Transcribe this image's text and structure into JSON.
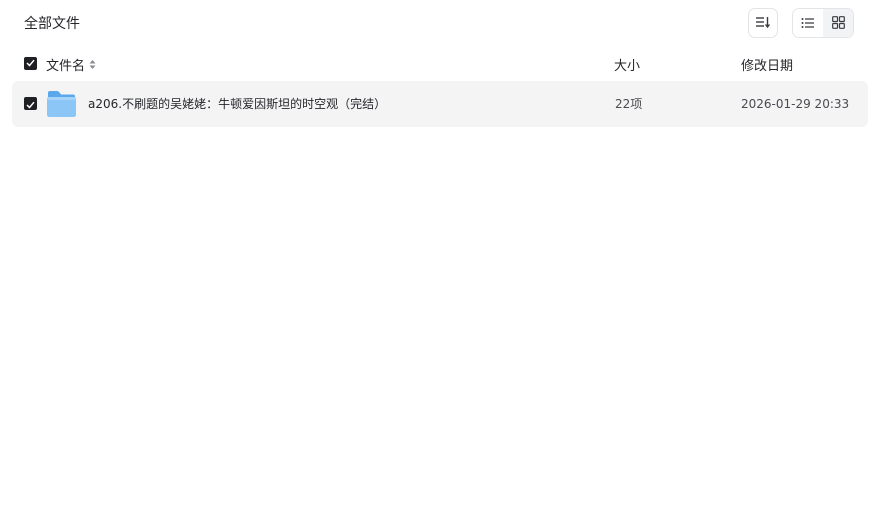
{
  "breadcrumb": {
    "title": "全部文件"
  },
  "toolbar": {
    "sort_icon": "sort-descending-icon",
    "view_list_icon": "list-view-icon",
    "view_grid_icon": "grid-view-icon",
    "active_view": "list"
  },
  "table": {
    "header": {
      "select_all_checked": true,
      "name": "文件名",
      "size": "大小",
      "modified": "修改日期"
    },
    "rows": [
      {
        "checked": true,
        "icon": "folder-icon",
        "name": "a206.不刷题的吴姥姥：牛顿爱因斯坦的时空观（完结）",
        "size": "22项",
        "modified": "2026-01-29 20:33"
      }
    ]
  },
  "colors": {
    "checkbox_fill": "#1f2024",
    "row_selected_bg": "#f4f4f5",
    "folder_blue": "#7cbef5",
    "border": "#e3e4e8"
  }
}
